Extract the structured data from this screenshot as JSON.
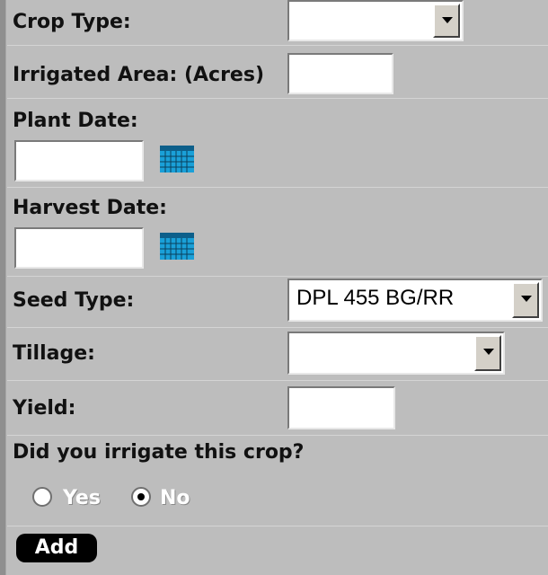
{
  "form": {
    "crop_type": {
      "label": "Crop Type:",
      "value": ""
    },
    "irrigated_area": {
      "label": "Irrigated Area: (Acres)",
      "value": ""
    },
    "plant_date": {
      "label": "Plant Date:",
      "value": ""
    },
    "harvest_date": {
      "label": "Harvest Date:",
      "value": ""
    },
    "seed_type": {
      "label": "Seed Type:",
      "value": "DPL 455 BG/RR"
    },
    "tillage": {
      "label": "Tillage:",
      "value": ""
    },
    "yield": {
      "label": "Yield:",
      "value": ""
    },
    "irrigate_question": "Did you irrigate this crop?",
    "irrigate_options": [
      {
        "label": "Yes",
        "checked": false
      },
      {
        "label": "No",
        "checked": true
      }
    ],
    "add_button": "Add"
  },
  "icons": {
    "calendar": "calendar-icon",
    "dropdown": "chevron-down-icon"
  },
  "colors": {
    "background": "#bdbdbd",
    "calendar_blue": "#1aa0d8",
    "button": "#000000"
  }
}
